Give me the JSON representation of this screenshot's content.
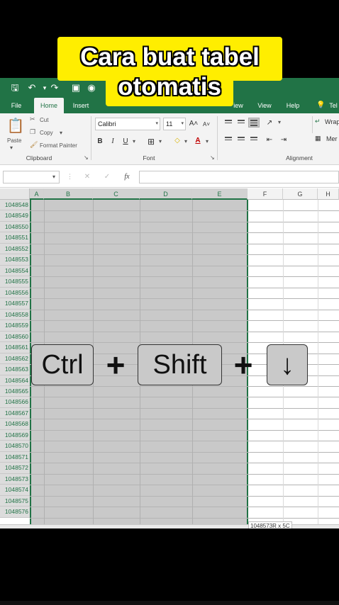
{
  "caption": {
    "line1": "Cara buat tabel",
    "line2": "otomatis"
  },
  "ribbon_tabs": [
    "File",
    "Home",
    "Insert",
    "iew",
    "View",
    "Help",
    "Tel"
  ],
  "clipboard": {
    "paste": "Paste",
    "cut": "Cut",
    "copy": "Copy",
    "format_painter": "Format Painter",
    "group": "Clipboard"
  },
  "font": {
    "family": "Calibri",
    "size": "11",
    "bold": "B",
    "italic": "I",
    "underline": "U",
    "group": "Font"
  },
  "alignment": {
    "wrap": "Wrap",
    "merge": "Mer",
    "group": "Alignment"
  },
  "formula_bar": {
    "cancel": "✕",
    "enter": "✓",
    "fx": "fx"
  },
  "columns": [
    "A",
    "B",
    "C",
    "D",
    "E",
    "F",
    "G",
    "H"
  ],
  "rows": [
    "1048548",
    "1048549",
    "1048550",
    "1048551",
    "1048552",
    "1048553",
    "1048554",
    "1048555",
    "1048556",
    "1048557",
    "1048558",
    "1048559",
    "1048560",
    "1048561",
    "1048562",
    "1048563",
    "1048564",
    "1048565",
    "1048566",
    "1048567",
    "1048568",
    "1048569",
    "1048570",
    "1048571",
    "1048572",
    "1048573",
    "1048574",
    "1048575",
    "1048576"
  ],
  "status": {
    "selection": "1048573R x 5C"
  },
  "keys": {
    "ctrl": "Ctrl",
    "shift": "Shift",
    "arrow": "↓",
    "plus": "+"
  },
  "colors": {
    "excel_green": "#217346",
    "caption_yellow": "#ffee00",
    "selection_gray": "#c9c9c9"
  }
}
